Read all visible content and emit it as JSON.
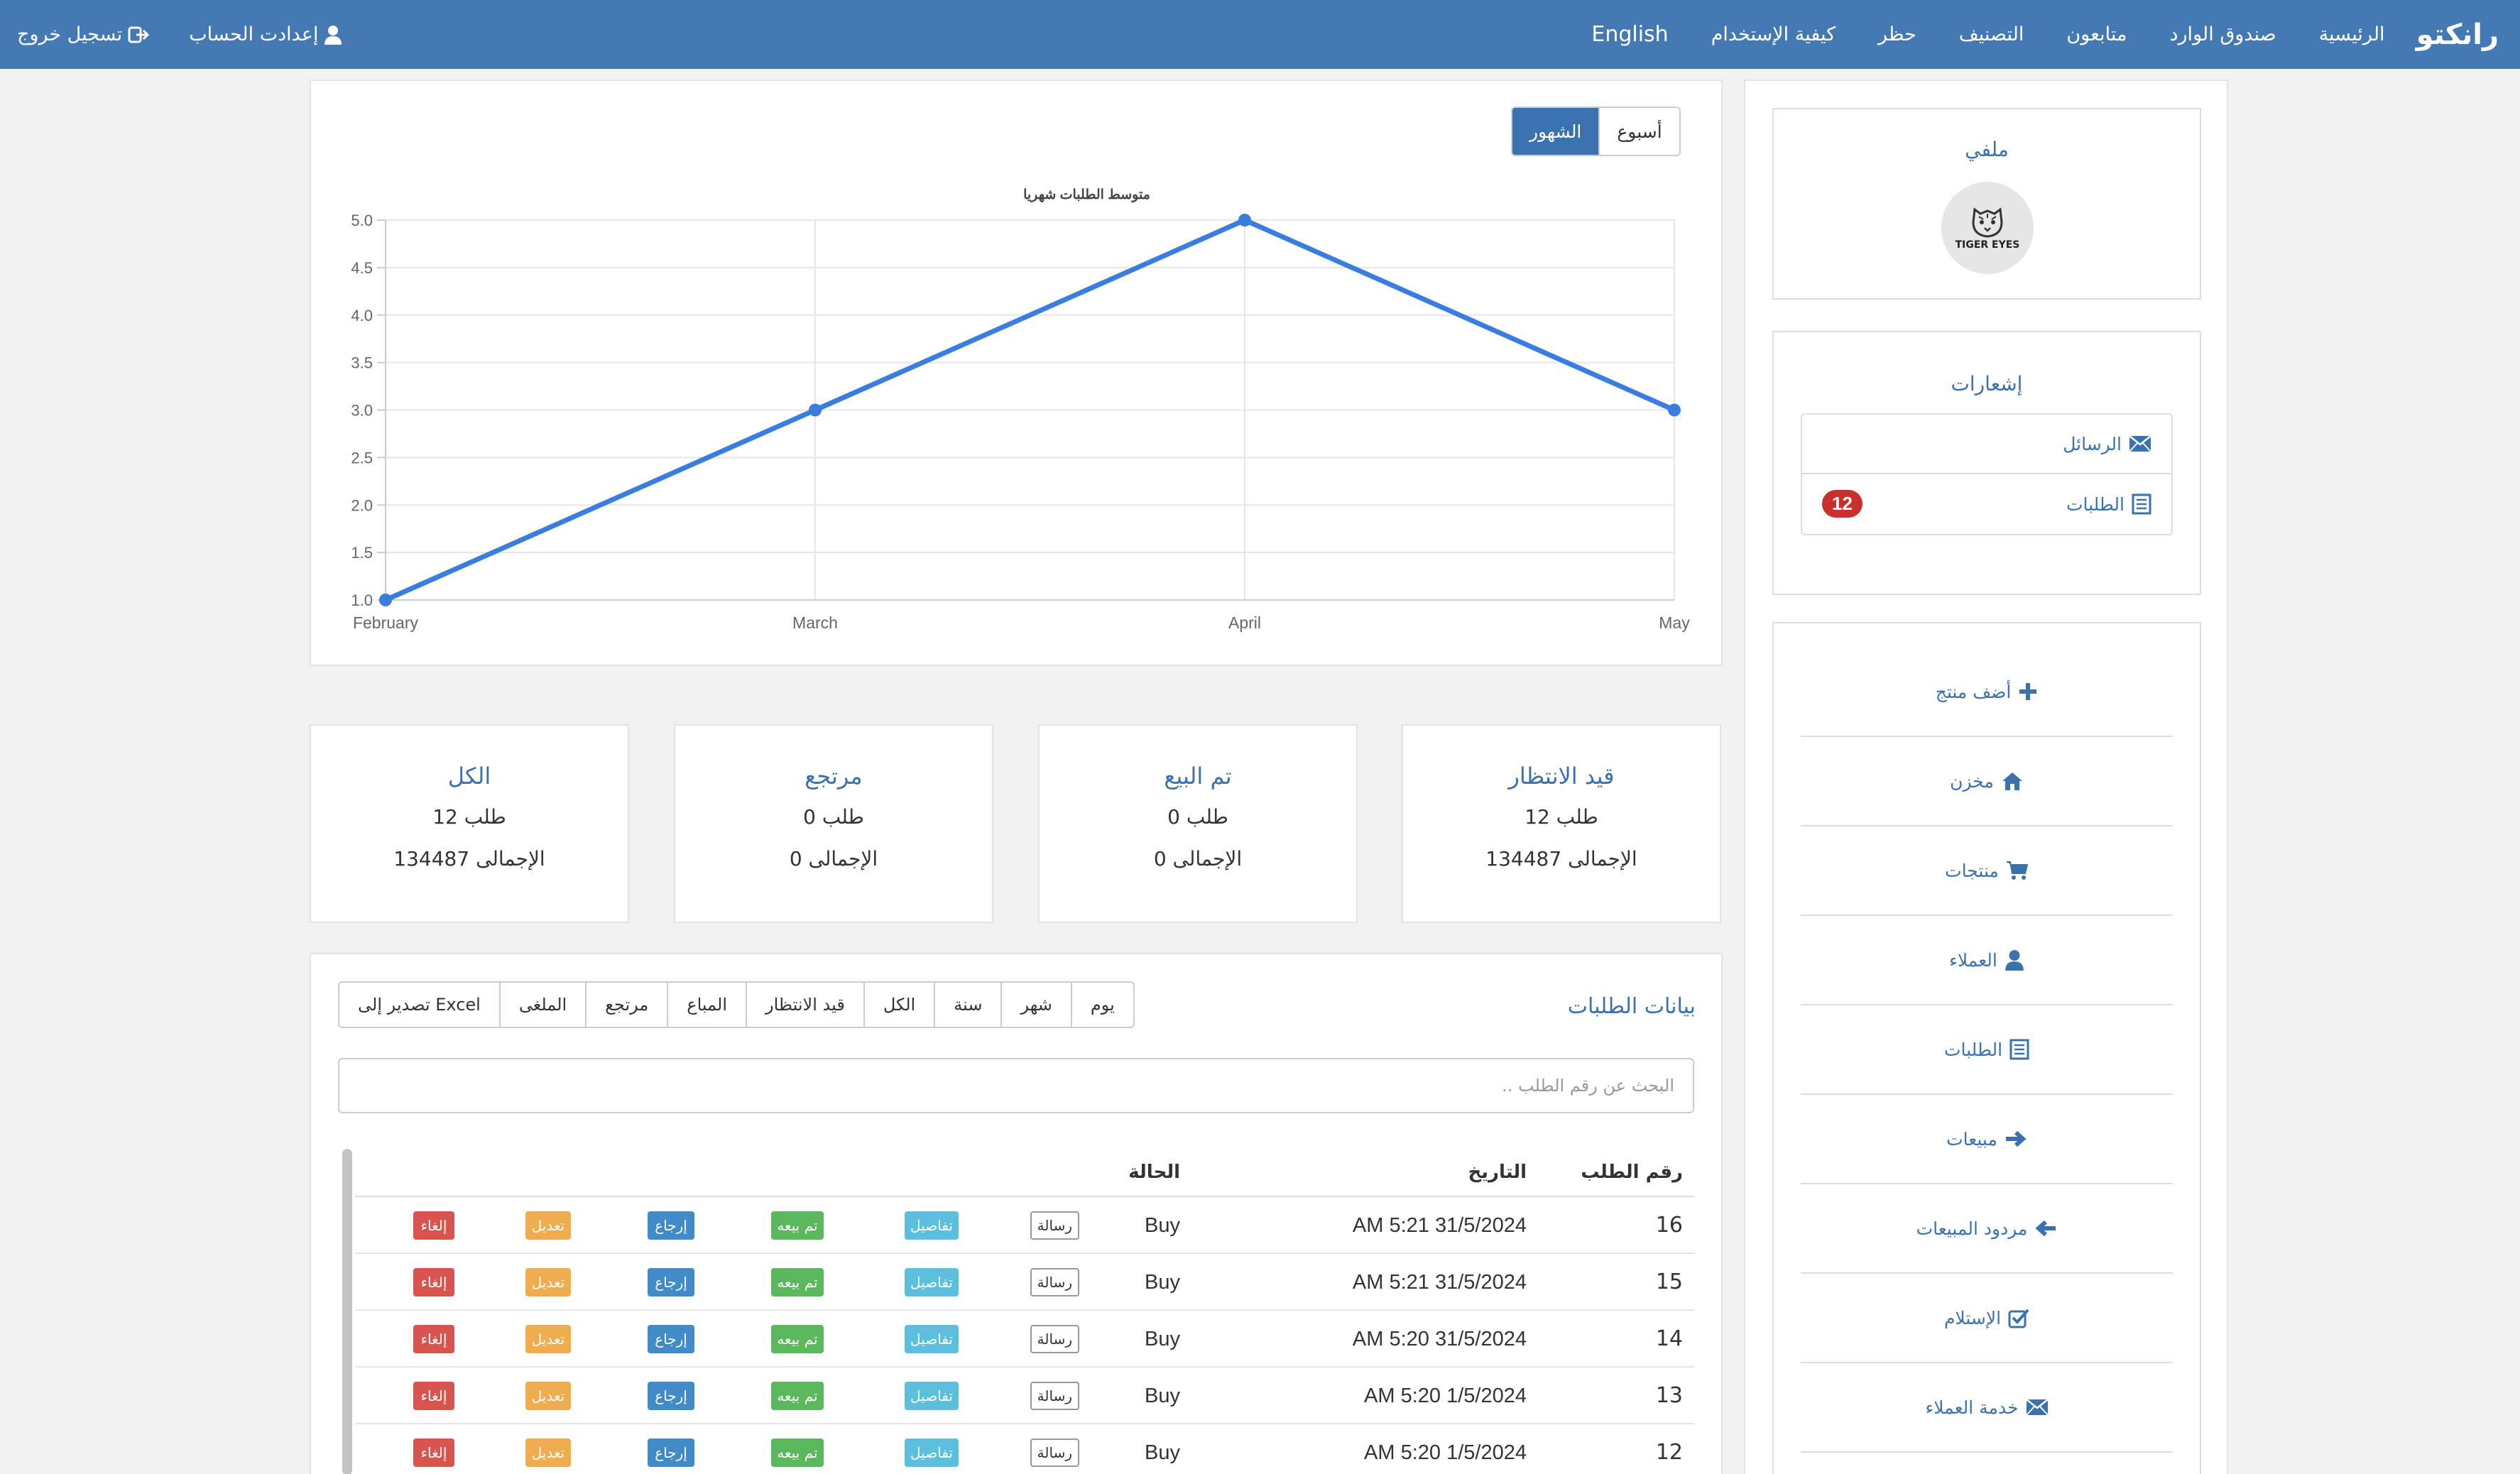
{
  "navbar": {
    "brand": "رانكتو",
    "items": [
      "الرئيسية",
      "صندوق الوارد",
      "متابعون",
      "التصنيف",
      "حظر",
      "كيفية الإستخدام"
    ],
    "language": "English",
    "account_settings": "إعدادت الحساب",
    "logout": "تسجيل خروج"
  },
  "chart_panel": {
    "toggle_month": "الشهور",
    "toggle_week": "أسبوع"
  },
  "chart_data": {
    "type": "line",
    "title": "متوسط الطلبات شهريا",
    "categories": [
      "February",
      "March",
      "April",
      "May"
    ],
    "values": [
      1.0,
      3.0,
      5.0,
      3.0
    ],
    "ylim": [
      1.0,
      5.0
    ],
    "yticks": [
      "1.0",
      "1.5",
      "2.0",
      "2.5",
      "3.0",
      "3.5",
      "4.0",
      "4.5",
      "5.0"
    ],
    "grid": true,
    "color": "#3a7de0"
  },
  "stats": [
    {
      "title": "قيد الانتظار",
      "count": "12 طلب",
      "sum": "134487 الإجمالى"
    },
    {
      "title": "تم البيع",
      "count": "0 طلب",
      "sum": "0 الإجمالى"
    },
    {
      "title": "مرتجع",
      "count": "0 طلب",
      "sum": "0 الإجمالى"
    },
    {
      "title": "الكل",
      "count": "12 طلب",
      "sum": "134487 الإجمالى"
    }
  ],
  "orders": {
    "title": "بيانات الطلبات",
    "filters": [
      "يوم",
      "شهر",
      "سنة",
      "الكل",
      "قيد الانتظار",
      "المباع",
      "مرتجع",
      "الملغى",
      "تصدير إلى Excel"
    ],
    "search_placeholder": "البحث عن رقم الطلب ..",
    "headers": {
      "num": "رقم الطلب",
      "date": "التاريخ",
      "status": "الحالة"
    },
    "actions": {
      "message": "رسالة",
      "details": "تفاصيل",
      "sold": "تم بيعه",
      "return": "إرجاع",
      "edit": "تعديل",
      "cancel": "إلغاء"
    },
    "rows": [
      {
        "num": "16",
        "date": "AM 5:21 31/5/2024",
        "status": "Buy"
      },
      {
        "num": "15",
        "date": "AM 5:21 31/5/2024",
        "status": "Buy"
      },
      {
        "num": "14",
        "date": "AM 5:20 31/5/2024",
        "status": "Buy"
      },
      {
        "num": "13",
        "date": "AM 5:20 1/5/2024",
        "status": "Buy"
      },
      {
        "num": "12",
        "date": "AM 5:20 1/5/2024",
        "status": "Buy"
      }
    ]
  },
  "sidebar": {
    "profile_title": "ملفي",
    "logo_text": "TIGER EYES",
    "notifications_title": "إشعارات",
    "notif_messages": "الرسائل",
    "notif_orders": "الطلبات",
    "notif_orders_count": "12",
    "menu": [
      "أضف منتج",
      "مخزن",
      "منتجات",
      "العملاء",
      "الطلبات",
      "مبيعات",
      "مردود المبيعات",
      "الإستلام",
      "خدمة العملاء"
    ]
  }
}
